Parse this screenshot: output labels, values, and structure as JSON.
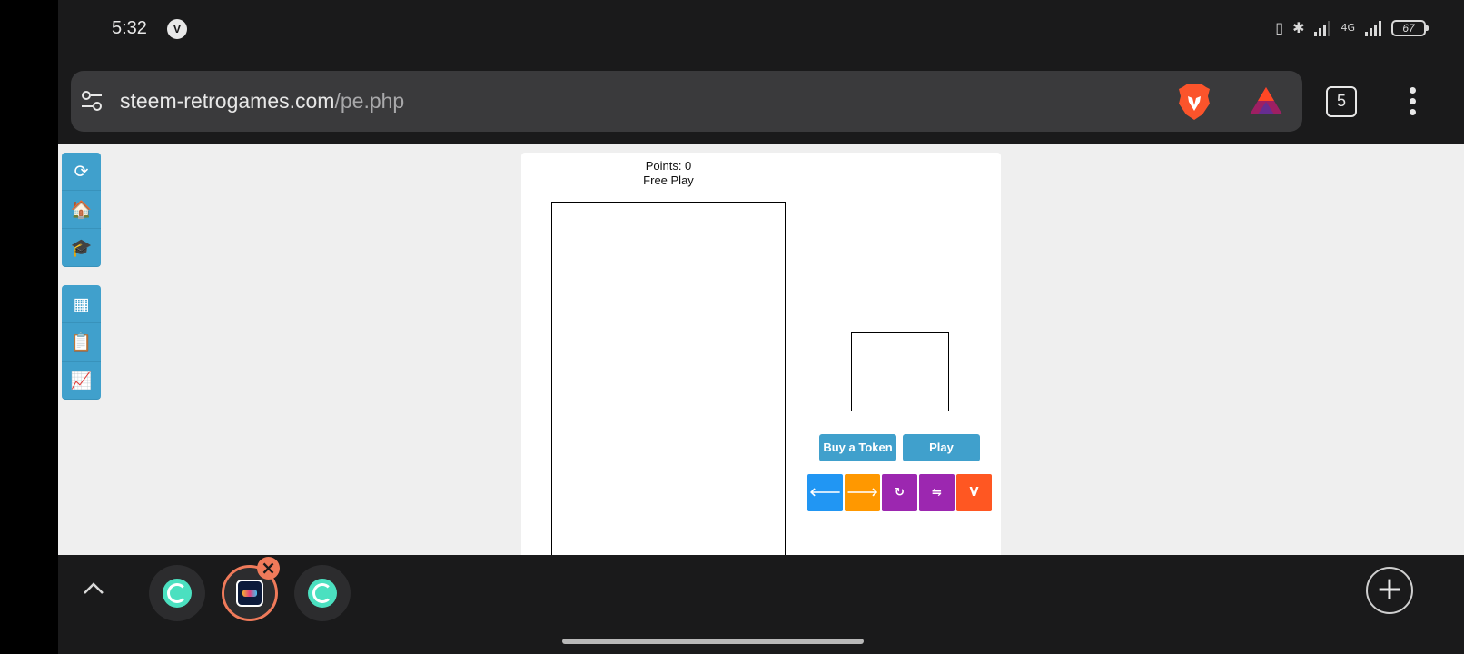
{
  "status_bar": {
    "time": "5:32",
    "vpn_badge": "V",
    "network": "4G",
    "battery_level": "67"
  },
  "browser": {
    "url_domain": "steem-retrogames.com",
    "url_path": "/pe.php",
    "tab_count": "5"
  },
  "side_menu": {
    "items": [
      {
        "icon": "reload-icon",
        "glyph": "⟳"
      },
      {
        "icon": "home-icon",
        "glyph": "🏠"
      },
      {
        "icon": "graduation-cap-icon",
        "glyph": "🎓"
      },
      {
        "icon": "grid-icon",
        "glyph": "▦"
      },
      {
        "icon": "clipboard-icon",
        "glyph": "📋"
      },
      {
        "icon": "chart-icon",
        "glyph": "📈"
      }
    ]
  },
  "game": {
    "points_label": "Points: 0",
    "mode_label": "Free Play",
    "buy_token_label": "Buy a Token",
    "play_label": "Play",
    "controls": [
      {
        "name": "move-left-button",
        "glyph": "🡐",
        "color": "#2196f3"
      },
      {
        "name": "move-right-button",
        "glyph": "🡒",
        "color": "#ff9800"
      },
      {
        "name": "rotate-button",
        "glyph": "↻",
        "color": "#9c27b0"
      },
      {
        "name": "flip-button",
        "glyph": "⇋",
        "color": "#9c27b0"
      },
      {
        "name": "drop-button",
        "glyph": "V",
        "color": "#ff5722"
      }
    ]
  },
  "colors": {
    "accent_blue": "#40a0cc",
    "active_tab_ring": "#ef7a5a"
  }
}
